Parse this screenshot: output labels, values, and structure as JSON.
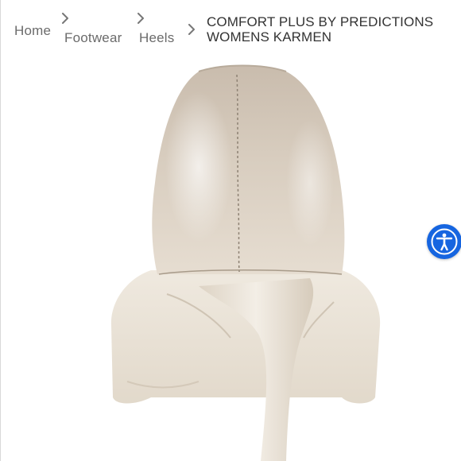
{
  "breadcrumb": {
    "items": [
      {
        "label": "Home"
      },
      {
        "label": "Footwear"
      },
      {
        "label": "Heels"
      }
    ],
    "current": {
      "line1": "COMFORT PLUS BY PREDICTIONS",
      "line2": "WOMENS KARMEN"
    }
  },
  "product_image": {
    "icon": "shoe-heel-back-view"
  },
  "accessibility_widget": {
    "icon": "accessibility-person-icon",
    "color": "#1665e0"
  }
}
